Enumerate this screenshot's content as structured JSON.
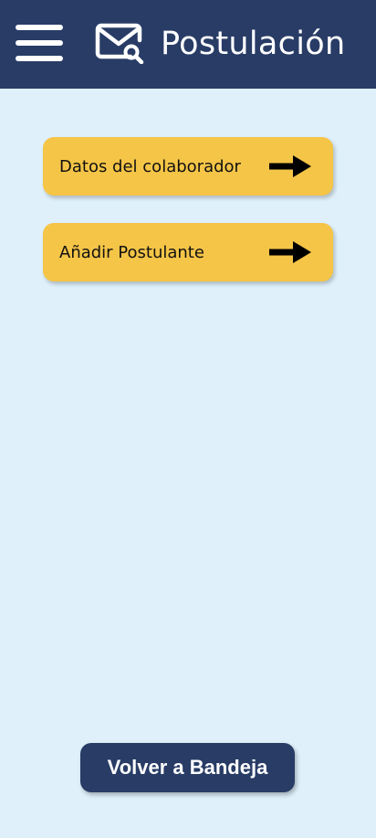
{
  "header": {
    "title": "Postulación",
    "menu_icon": "hamburger-menu-icon",
    "mail_icon": "mail-search-icon",
    "background": "#283c66"
  },
  "options": [
    {
      "label": "Datos del colaborador",
      "icon": "arrow-right-icon"
    },
    {
      "label": "Añadir Postulante",
      "icon": "arrow-right-icon"
    }
  ],
  "footer": {
    "back_label": "Volver a Bandeja"
  },
  "colors": {
    "page_background": "#dff0fa",
    "option_background": "#f5c547",
    "primary": "#283c66"
  }
}
